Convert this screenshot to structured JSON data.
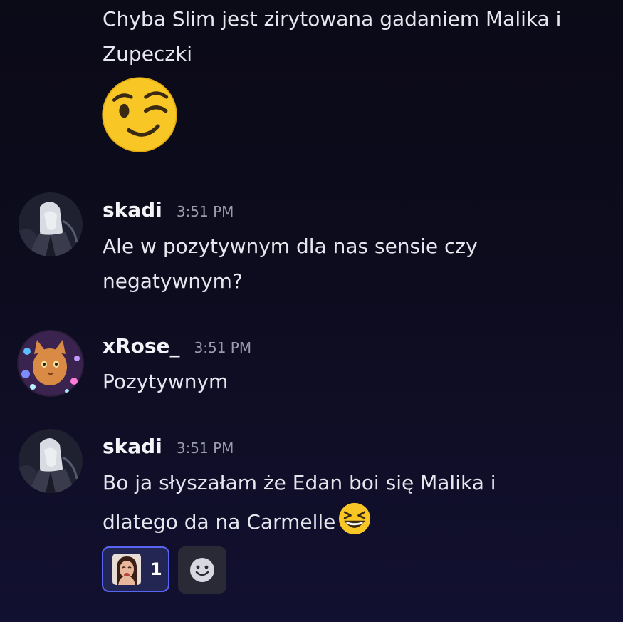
{
  "messages": [
    {
      "username": "",
      "time": "",
      "lines": [
        "Chyba Slim jest zirytowana gadaniem Malika i",
        "Zupeczki"
      ],
      "emoji": "winking-face"
    },
    {
      "username": "skadi",
      "time": "3:51 PM",
      "lines": [
        "Ale w pozytywnym dla nas sensie czy",
        "negatywnym?"
      ]
    },
    {
      "username": "xRose_",
      "time": "3:51 PM",
      "lines": [
        "Pozytywnym"
      ]
    },
    {
      "username": "skadi",
      "time": "3:51 PM",
      "lines": [
        "Bo ja słyszałam że Edan boi się Malika i",
        "dlatego da na Carmelle"
      ],
      "inline_emoji": "grinning-squinting-face",
      "reactions": [
        {
          "emoji": "custom-crying-person",
          "count": "1",
          "active": true
        }
      ]
    }
  ],
  "icons": {
    "add_reaction": "smiley-add-reaction-icon"
  },
  "colors": {
    "background": "#0d0c1e",
    "reaction_active_border": "#5865f2",
    "reaction_active_bg": "#232652",
    "timestamp": "#9b9cab"
  }
}
